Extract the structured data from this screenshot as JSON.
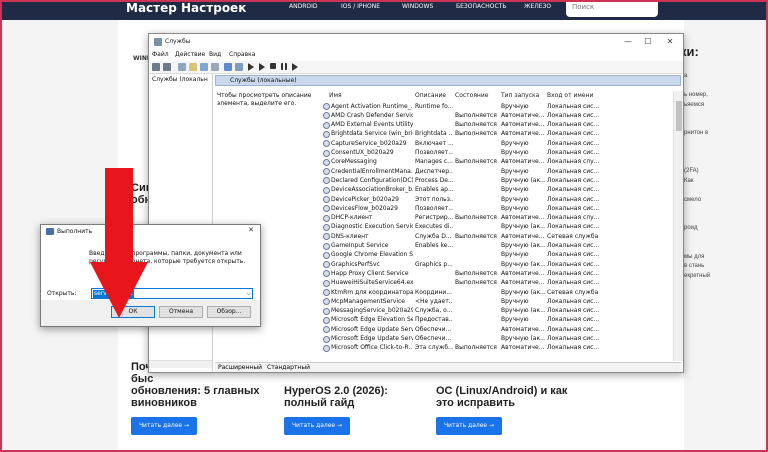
{
  "site": {
    "logo": "Мастер Настроек",
    "nav": [
      "ANDROID",
      "IOS / IPHONE",
      "WINDOWS",
      "БЕЗОПАСНОСТЬ",
      "ЖЕЛЕЗО"
    ],
    "search_placeholder": "Поиск"
  },
  "background": {
    "right_title": "йки:",
    "right_links": [
      "а",
      "",
      "ь номер,",
      "ьяемся",
      "",
      "",
      "рнитон в",
      "",
      "",
      "",
      "(2FA)",
      "Как",
      "",
      "смело",
      "",
      "",
      "роид",
      "",
      "",
      "мы для",
      "в стань",
      "екретный"
    ],
    "windows_label": "WIND",
    "card1_frag": "Син",
    "card1_frag2": "обн",
    "cards": [
      {
        "title": "Поч быс обновления: 5 главных виновников",
        "line1": "Поч",
        "line2": "быс",
        "line3": "обновления: 5 главных",
        "line4": "виновников",
        "button": "Читать далее →"
      },
      {
        "title": "HyperOS 2.0 (2026): полный гайд",
        "line1": "HyperOS 2.0 (2026):",
        "line2": "полный гайд",
        "button": "Читать далее →"
      },
      {
        "title": "ОС (Linux/Android) и как это исправить",
        "line1": "ОС (Linux/Android) и как",
        "line2": "это исправить",
        "button": "Читать далее →"
      }
    ]
  },
  "services_window": {
    "title": "Службы",
    "menu": [
      "Файл",
      "Действие",
      "Вид",
      "Справка"
    ],
    "tree_item": "Службы (локальн",
    "header_label": "Службы (локальные)",
    "description": "Чтобы просмотреть описание элемента, выделите его.",
    "columns": [
      "Имя",
      "Описание",
      "Состояние",
      "Тип запуска",
      "Вход от имени"
    ],
    "rows": [
      [
        "Agent Activation Runtime_...",
        "Runtime fo...",
        "",
        "Вручную",
        "Локальная сис..."
      ],
      [
        "AMD Crash Defender Service",
        "",
        "Выполняется",
        "Автоматиче...",
        "Локальная сис..."
      ],
      [
        "AMD External Events Utility",
        "",
        "Выполняется",
        "Автоматиче...",
        "Локальная сис..."
      ],
      [
        "Brightdata Service (win_brig...",
        "Brightdata ...",
        "Выполняется",
        "Автоматиче...",
        "Локальная сис..."
      ],
      [
        "CaptureService_b020a29",
        "Включает ...",
        "",
        "Вручную",
        "Локальная сис..."
      ],
      [
        "ConsentUX_b020a29",
        "Позволяет...",
        "",
        "Вручную",
        "Локальная сис..."
      ],
      [
        "CoreMessaging",
        "Manages c...",
        "Выполняется",
        "Автоматиче...",
        "Локальная слу..."
      ],
      [
        "CredentialEnrollmentMana...",
        "Диспетчер...",
        "",
        "Вручную",
        "Локальная сис..."
      ],
      [
        "Declared Configuration(DC)...",
        "Process De...",
        "",
        "Вручную (ак...",
        "Локальная сис..."
      ],
      [
        "DeviceAssociationBroker_b...",
        "Enables ap...",
        "",
        "Вручную",
        "Локальная сис..."
      ],
      [
        "DevicePicker_b020a29",
        "Этот польз...",
        "",
        "Вручную",
        "Локальная сис..."
      ],
      [
        "DevicesFlow_b020a29",
        "Позволяет...",
        "",
        "Вручную",
        "Локальная сис..."
      ],
      [
        "DHCP-клиент",
        "Регистрир...",
        "Выполняется",
        "Автоматиче...",
        "Локальная слу..."
      ],
      [
        "Diagnostic Execution Service",
        "Executes di...",
        "",
        "Вручную (ак...",
        "Локальная сис..."
      ],
      [
        "DNS-клиент",
        "Служба D...",
        "Выполняется",
        "Автоматиче...",
        "Сетевая служба"
      ],
      [
        "GameInput Service",
        "Enables ke...",
        "",
        "Вручную (ак...",
        "Локальная сис..."
      ],
      [
        "Google Chrome Elevation S...",
        "",
        "",
        "Вручную",
        "Локальная сис..."
      ],
      [
        "GraphicsPerfSvc",
        "Graphics p...",
        "",
        "Вручную (ак...",
        "Локальная сис..."
      ],
      [
        "Happ Proxy Client Service",
        "",
        "Выполняется",
        "Автоматиче...",
        "Локальная сис..."
      ],
      [
        "HuaweiHiSuiteService64.exe",
        "",
        "Выполняется",
        "Автоматиче...",
        "Локальная сис..."
      ],
      [
        "KtmRm для координатора ...",
        "Координи...",
        "",
        "Вручную (ак...",
        "Сетевая служба"
      ],
      [
        "McpManagementService",
        "<Не удает...",
        "",
        "Вручную",
        "Локальная сис..."
      ],
      [
        "MessagingService_b020a29",
        "Служба, о...",
        "",
        "Вручную (ак...",
        "Локальная сис..."
      ],
      [
        "Microsoft Edge Elevation Se...",
        "Предостав...",
        "",
        "Вручную",
        "Локальная сис..."
      ],
      [
        "Microsoft Edge Update Serv...",
        "Обеспечи...",
        "",
        "Автоматиче...",
        "Локальная сис..."
      ],
      [
        "Microsoft Edge Update Serv...",
        "Обеспечи...",
        "",
        "Вручную (ак...",
        "Локальная сис..."
      ],
      [
        "Microsoft Office Click-to-R...",
        "Эта служб...",
        "Выполняется",
        "Автоматиче...",
        "Локальная сис..."
      ]
    ],
    "tabs": [
      "Расширенный",
      "Стандартный"
    ]
  },
  "run_dialog": {
    "title": "Выполнить",
    "description": "Введите имя программы, папки, документа или ресурса Интернета, которые требуется открыть.",
    "open_label": "Открыть:",
    "input_value": "services.msc",
    "buttons": [
      "ОК",
      "Отмена",
      "Обзор..."
    ]
  },
  "colors": {
    "header_bg": "#1f2b44",
    "accent": "#1a73e8",
    "arrow": "#e8151b",
    "selection": "#0078d7"
  }
}
